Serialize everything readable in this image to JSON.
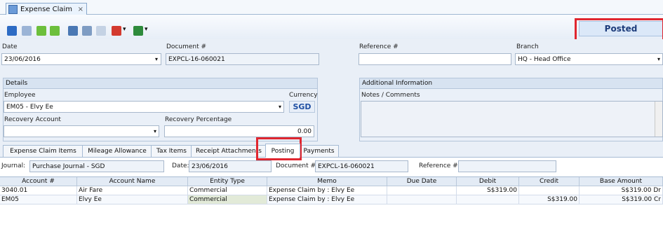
{
  "window": {
    "tab_title": "Expense Claim",
    "close_glyph": "×"
  },
  "toolbar": {
    "icons": [
      "help-icon",
      "grid-icon",
      "back-icon",
      "forward-icon",
      "save-icon",
      "refresh-icon",
      "copy-icon",
      "print-icon",
      "excel-icon"
    ]
  },
  "status": {
    "label": "Posted"
  },
  "header": {
    "date_label": "Date",
    "date_value": "23/06/2016",
    "document_label": "Document #",
    "document_value": "EXPCL-16-060021",
    "reference_label": "Reference #",
    "reference_value": "",
    "branch_label": "Branch",
    "branch_value": "HQ - Head Office"
  },
  "details": {
    "title": "Details",
    "employee_label": "Employee",
    "employee_value": "EM05 - Elvy Ee",
    "currency_label": "Currency",
    "currency_value": "SGD",
    "recovery_account_label": "Recovery Account",
    "recovery_account_value": "",
    "recovery_percentage_label": "Recovery Percentage",
    "recovery_percentage_value": "0.00"
  },
  "additional": {
    "title": "Additional Information",
    "notes_label": "Notes / Comments",
    "notes_value": ""
  },
  "tabs": [
    {
      "label": "Expense Claim Items"
    },
    {
      "label": "Mileage Allowance"
    },
    {
      "label": "Tax Items"
    },
    {
      "label": "Receipt Attachments"
    },
    {
      "label": "Posting"
    },
    {
      "label": "Payments"
    }
  ],
  "posting": {
    "journal_label": "Journal:",
    "journal_value": "Purchase Journal - SGD",
    "date_label": "Date:",
    "date_value": "23/06/2016",
    "document_label": "Document #:",
    "document_value": "EXPCL-16-060021",
    "reference_label": "Reference #:",
    "reference_value": ""
  },
  "grid": {
    "columns": [
      "Account #",
      "Account Name",
      "Entity Type",
      "Memo",
      "Due Date",
      "Debit",
      "Credit",
      "Base Amount"
    ],
    "rows": [
      [
        "3040.01",
        "Air Fare",
        "Commercial",
        "Expense Claim by : Elvy Ee",
        "",
        "S$319.00",
        "",
        "S$319.00 Dr"
      ],
      [
        "EM05",
        "Elvy Ee",
        "Commercial",
        "Expense Claim by : Elvy Ee",
        "",
        "",
        "S$319.00",
        "S$319.00 Cr"
      ]
    ]
  },
  "colors": {
    "highlight": "#e0262f",
    "status_text": "#1d3c7b",
    "currency_text": "#1f4fa3"
  }
}
